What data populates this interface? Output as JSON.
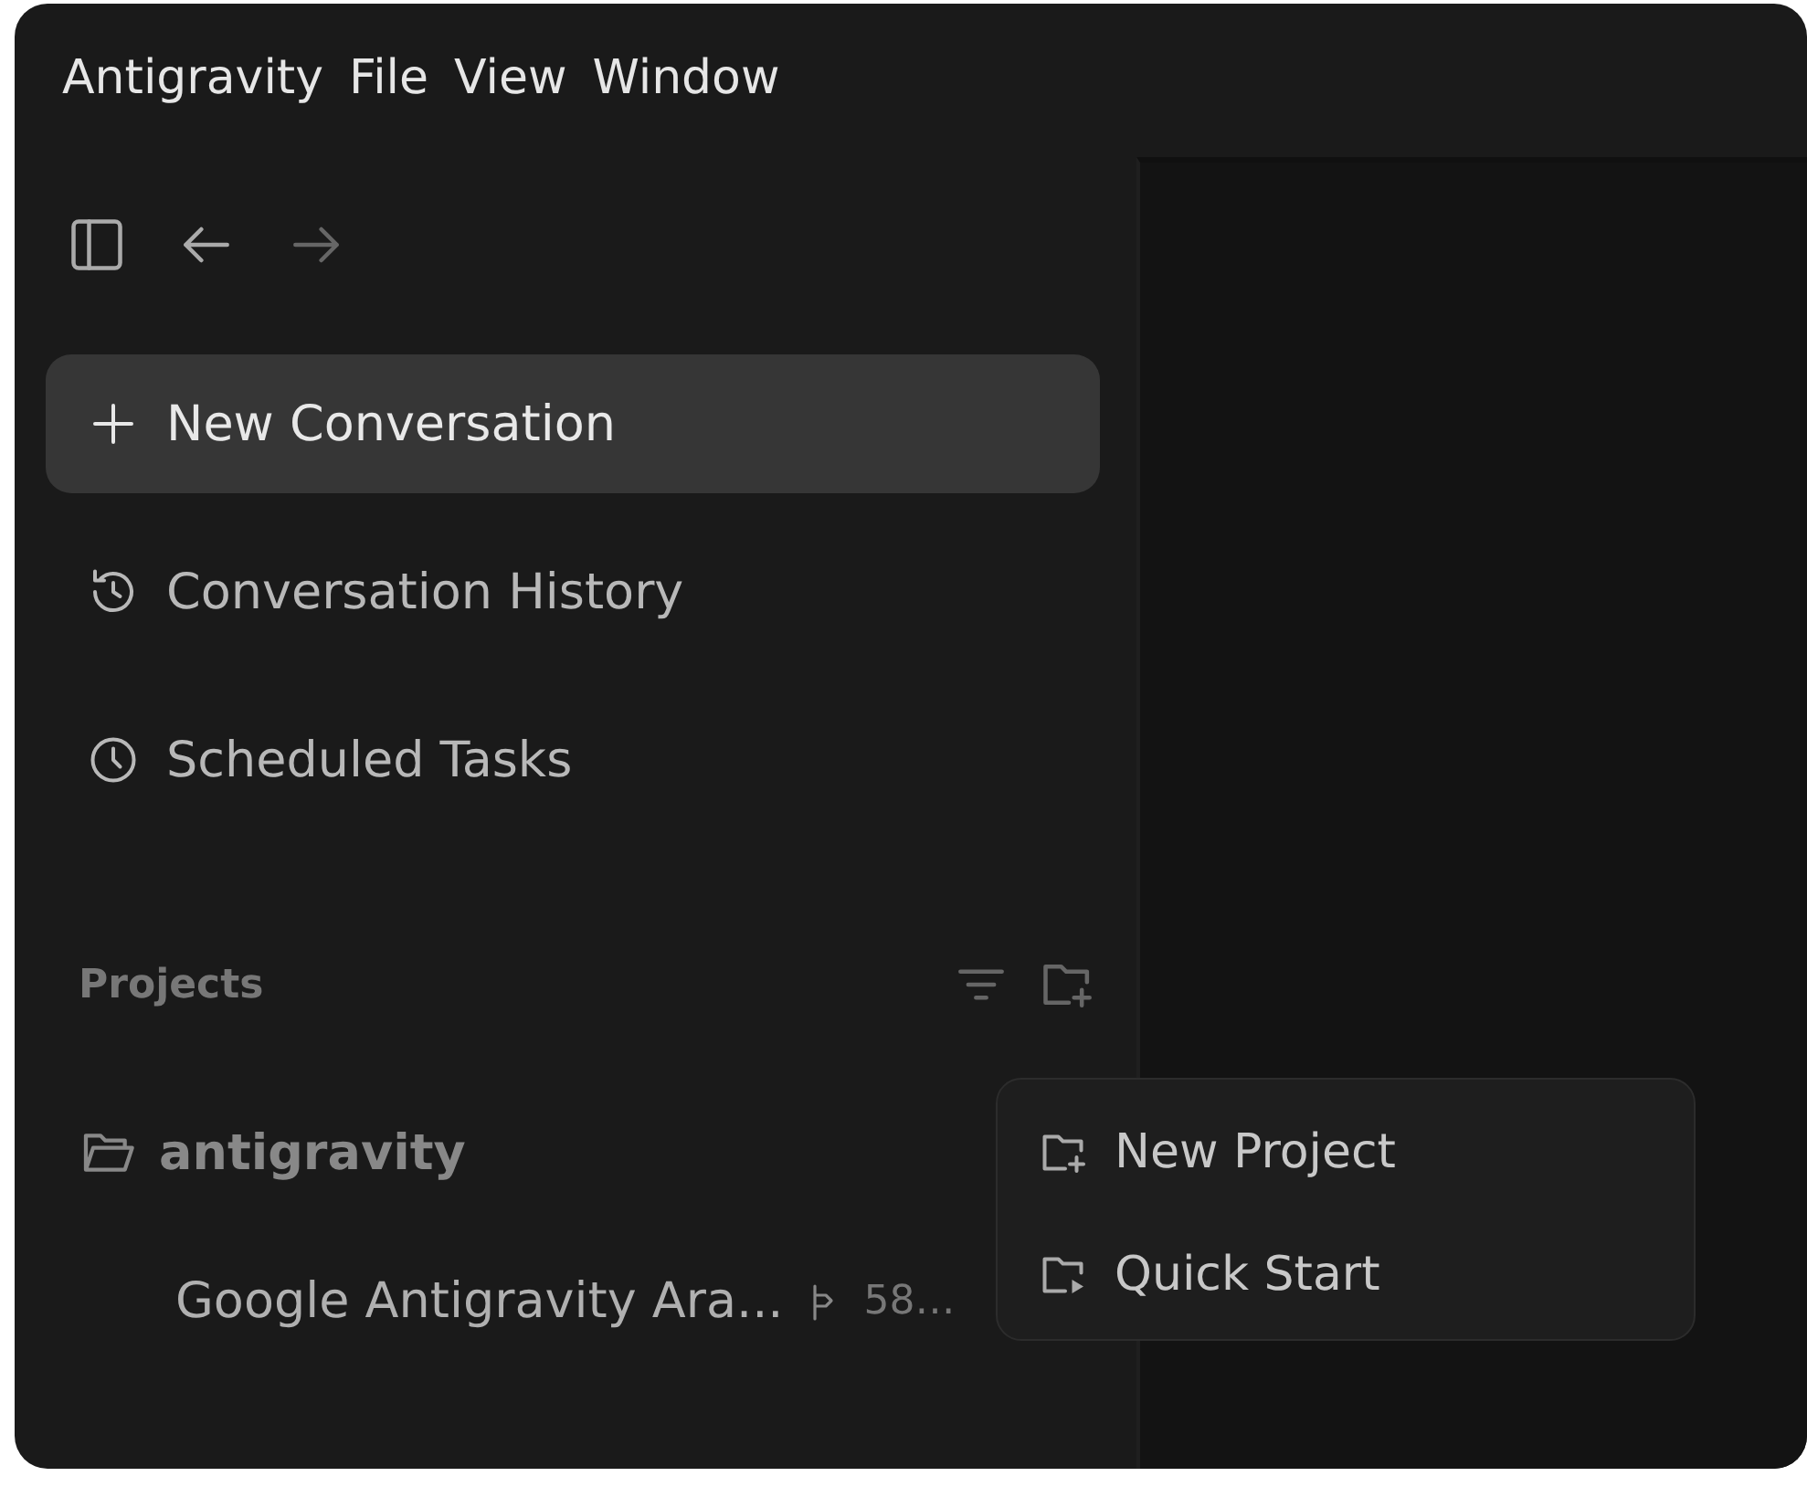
{
  "menu_bar": [
    "Antigravity",
    "File",
    "View",
    "Window"
  ],
  "toolbar": [
    {
      "kind": "sidebar-toggle",
      "disabled": false
    },
    {
      "kind": "back",
      "disabled": false
    },
    {
      "kind": "forward",
      "disabled": true
    }
  ],
  "nav": [
    {
      "kind": "new",
      "label": "New Conversation",
      "selected": true
    },
    {
      "kind": "history",
      "label": "Conversation History",
      "selected": false
    },
    {
      "kind": "scheduled",
      "label": "Scheduled Tasks",
      "selected": false
    }
  ],
  "projects": {
    "title": "Projects",
    "items": [
      {
        "name": "antigravity",
        "children": [
          {
            "name": "Google Antigravity Ara...",
            "meta": "58…"
          }
        ]
      }
    ]
  },
  "popup_menu": [
    {
      "kind": "new-project",
      "label": "New Project"
    },
    {
      "kind": "quick-start",
      "label": "Quick Start"
    }
  ]
}
